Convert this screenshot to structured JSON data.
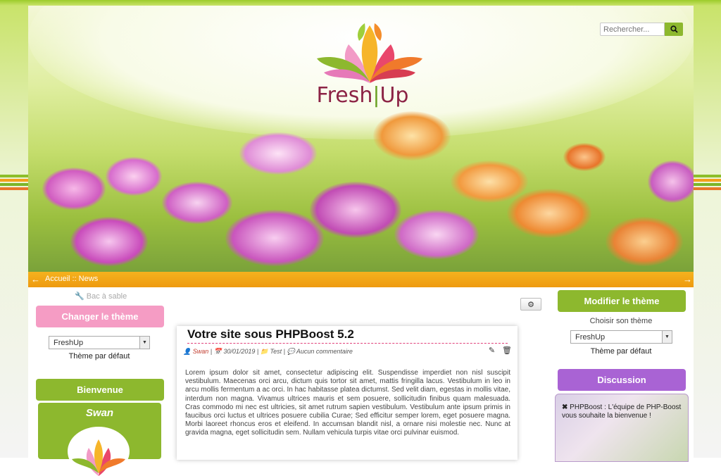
{
  "header": {
    "logo_left": "Fresh",
    "logo_right": "Up",
    "search_placeholder": "Rechercher...",
    "search_icon": "search-icon"
  },
  "breadcrumb": {
    "items": "Accueil :: News",
    "left_icon": "arrow-left-icon",
    "right_icon": "arrow-right-icon"
  },
  "sandbox_link": "Bac à sable",
  "left_column": {
    "change_theme_title": "Changer le thème",
    "theme_select_value": "FreshUp",
    "theme_default_label": "Thème par défaut",
    "welcome_title": "Bienvenue",
    "user_name": "Swan"
  },
  "article": {
    "title": "Votre site sous PHPBoost 5.2",
    "author": "Swan",
    "date": "30/01/2019",
    "category": "Test",
    "comments": "Aucun commentaire",
    "body": "Lorem ipsum dolor sit amet, consectetur adipiscing elit. Suspendisse imperdiet non nisl suscipit vestibulum. Maecenas orci arcu, dictum quis tortor sit amet, mattis fringilla lacus. Vestibulum in leo in arcu mollis fermentum a ac orci. In hac habitasse platea dictumst. Sed velit diam, egestas in mollis vitae, interdum non magna. Vivamus ultrices mauris et sem posuere, sollicitudin finibus quam malesuada. Cras commodo mi nec est ultricies, sit amet rutrum sapien vestibulum. Vestibulum ante ipsum primis in faucibus orci luctus et ultrices posuere cubilia Curae; Sed efficitur semper lorem, eget posuere magna. Morbi laoreet rhoncus eros et eleifend. In accumsan blandit nisl, a ornare nisi molestie nec. Nunc at gravida magna, eget sollicitudin sem. Nullam vehicula turpis vitae orci pulvinar euismod."
  },
  "right_column": {
    "modify_theme_title": "Modifier le thème",
    "choose_theme_label": "Choisir son thème",
    "theme_select_value": "FreshUp",
    "theme_default_label": "Thème par défaut",
    "discussion_title": "Discussion",
    "chat_message": "PHPBoost : L'équipe de PHP-Boost vous souhaite la bienvenue !"
  },
  "colors": {
    "green": "#8db82e",
    "pink": "#f59cc4",
    "purple": "#a963d4",
    "orange": "#f5a11c"
  }
}
